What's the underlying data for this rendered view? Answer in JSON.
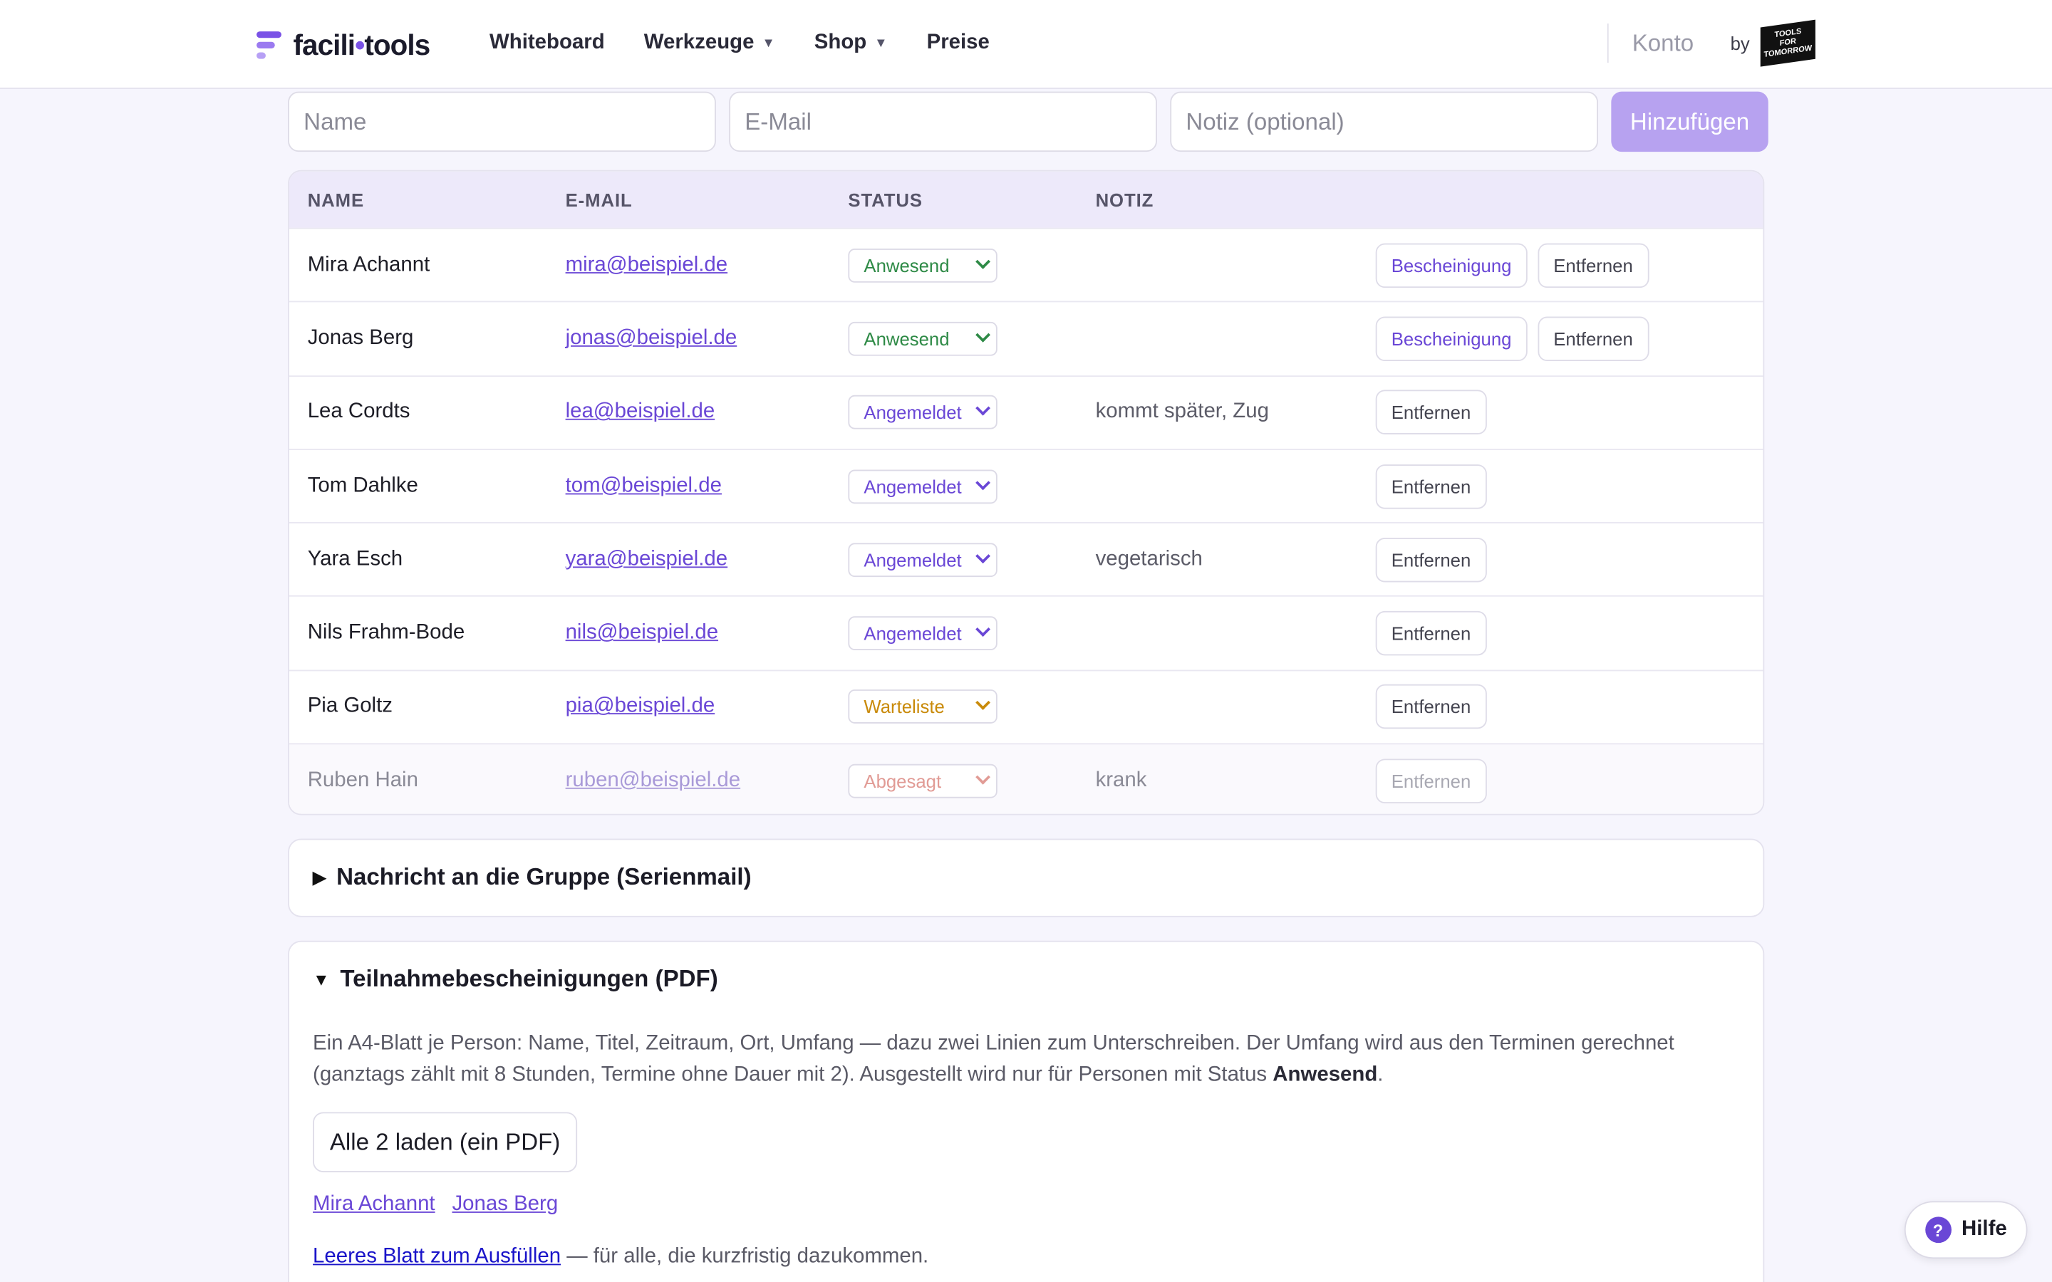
{
  "nav": {
    "logo_prefix": "facili",
    "logo_dot": "•",
    "logo_suffix": "tools",
    "links": [
      "Whiteboard",
      "Werkzeuge",
      "Shop",
      "Preise"
    ],
    "konto": "Konto",
    "by": "by",
    "tft_lines": [
      "TOOLS",
      "FOR",
      "TOMORROW"
    ]
  },
  "form": {
    "name_placeholder": "Name",
    "email_placeholder": "E-Mail",
    "note_placeholder": "Notiz (optional)",
    "add_label": "Hinzufügen"
  },
  "table": {
    "headers": [
      "NAME",
      "E-MAIL",
      "STATUS",
      "NOTIZ"
    ],
    "rows": [
      {
        "name": "Mira Achannt",
        "email": "mira@beispiel.de",
        "status": "Anwesend",
        "note": "",
        "certificate": "Bescheinigung",
        "remove": "Entfernen"
      },
      {
        "name": "Jonas Berg",
        "email": "jonas@beispiel.de",
        "status": "Anwesend",
        "note": "",
        "certificate": "Bescheinigung",
        "remove": "Entfernen"
      },
      {
        "name": "Lea Cordts",
        "email": "lea@beispiel.de",
        "status": "Angemeldet",
        "note": "kommt später, Zug",
        "remove": "Entfernen"
      },
      {
        "name": "Tom Dahlke",
        "email": "tom@beispiel.de",
        "status": "Angemeldet",
        "note": "",
        "remove": "Entfernen"
      },
      {
        "name": "Yara Esch",
        "email": "yara@beispiel.de",
        "status": "Angemeldet",
        "note": "vegetarisch",
        "remove": "Entfernen"
      },
      {
        "name": "Nils Frahm-Bode",
        "email": "nils@beispiel.de",
        "status": "Angemeldet",
        "note": "",
        "remove": "Entfernen"
      },
      {
        "name": "Pia Goltz",
        "email": "pia@beispiel.de",
        "status": "Warteliste",
        "note": "",
        "remove": "Entfernen"
      },
      {
        "name": "Ruben Hain",
        "email": "ruben@beispiel.de",
        "status": "Abgesagt",
        "note": "krank",
        "remove": "Entfernen"
      }
    ]
  },
  "group_mail": {
    "title": "Nachricht an die Gruppe (Serienmail)"
  },
  "certificates": {
    "title": "Teilnahmebescheinigungen (PDF)",
    "desc_pre": "Ein A4-Blatt je Person: Name, Titel, Zeitraum, Ort, Umfang — dazu zwei Linien zum Unterschreiben. Der Umfang wird aus den Terminen gerechnet (ganztags zählt mit 8 Stunden, Termine ohne Dauer mit 2). Ausgestellt wird nur für Personen mit Status ",
    "desc_bold": "Anwesend",
    "desc_post": ".",
    "load_all": "Alle 2 laden (ein PDF)",
    "person_links": [
      "Mira Achannt",
      "Jonas Berg"
    ],
    "blank_link": "Leeres Blatt zum Ausfüllen",
    "blank_rest": " — für alle, die kurzfristig dazukommen."
  },
  "help": {
    "icon": "?",
    "label": "Hilfe"
  },
  "colors": {
    "accent": "#6a47d6",
    "anwesend": "#2e8a46",
    "warteliste": "#c98a0a",
    "abgesagt": "#d0635a"
  }
}
